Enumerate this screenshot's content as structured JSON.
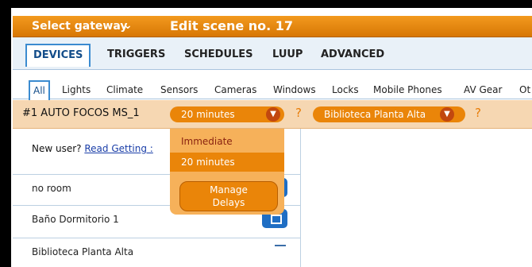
{
  "header": {
    "gateway_label": "Select gateway",
    "chevron": "chevron-down-icon",
    "title": "Edit scene no. 17"
  },
  "main_tabs": [
    {
      "label": "DEVICES",
      "active": true
    },
    {
      "label": "TRIGGERS"
    },
    {
      "label": "SCHEDULES"
    },
    {
      "label": "LUUP"
    },
    {
      "label": "ADVANCED"
    }
  ],
  "category_tabs": [
    {
      "label": "All",
      "active": true
    },
    {
      "label": "Lights"
    },
    {
      "label": "Climate"
    },
    {
      "label": "Sensors"
    },
    {
      "label": "Cameras"
    },
    {
      "label": "Windows"
    },
    {
      "label": "Locks"
    },
    {
      "label": "Mobile Phones"
    },
    {
      "label": "AV Gear"
    },
    {
      "label": "Ot"
    }
  ],
  "device_bar": {
    "device_name": "#1 AUTO FOCOS MS_1",
    "delay_value": "20 minutes",
    "help": "?",
    "room_value": "Biblioteca Planta Alta",
    "room_help": "?"
  },
  "delay_dropdown": {
    "options": [
      "Immediate",
      "20 minutes"
    ],
    "selected": "20 minutes",
    "manage_line1": "Manage",
    "manage_line2": "Delays"
  },
  "new_user": {
    "prefix": "New user?",
    "link": "Read Getting :"
  },
  "rooms": [
    {
      "name": "no room"
    },
    {
      "name": "Baño Dormitorio 1"
    },
    {
      "name": "Biblioteca Planta Alta"
    }
  ],
  "colors": {
    "accent": "#ea8509",
    "tab_border": "#3b8bd0",
    "room_button": "#1f6ec4"
  }
}
